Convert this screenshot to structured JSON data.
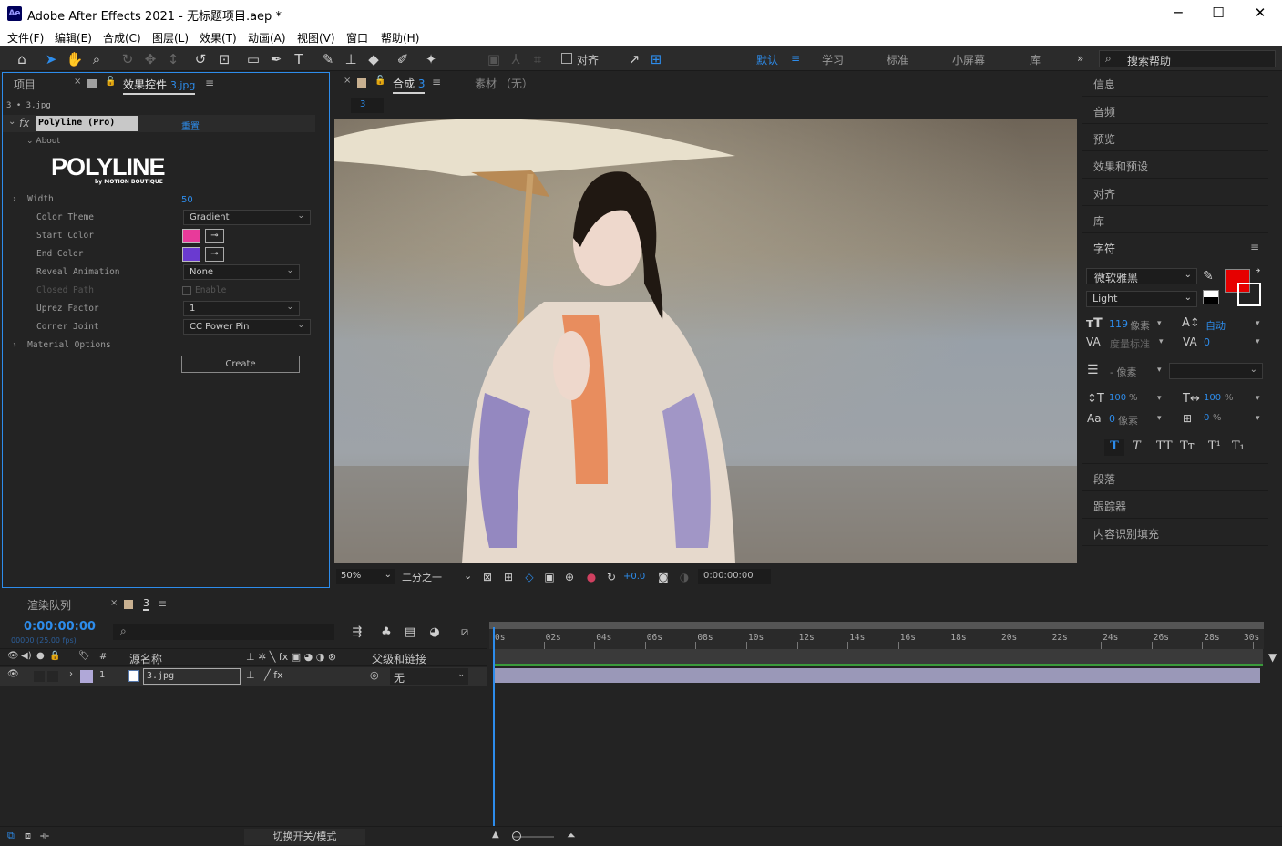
{
  "window": {
    "title": "Adobe After Effects 2021 - 无标题项目.aep *",
    "logo": "Ae",
    "minimize": "─",
    "maximize": "☐",
    "close": "✕"
  },
  "menu": [
    "文件(F)",
    "编辑(E)",
    "合成(C)",
    "图层(L)",
    "效果(T)",
    "动画(A)",
    "视图(V)",
    "窗口",
    "帮助(H)"
  ],
  "toolbar": {
    "align_label": "对齐",
    "workspaces": [
      "默认",
      "学习",
      "标准",
      "小屏幕",
      "库"
    ],
    "more": "»",
    "search_placeholder": "搜索帮助"
  },
  "left_panel": {
    "tab_project": "项目",
    "tab_effects": "效果控件",
    "tab_effects_file": "3.jpg",
    "breadcrumb": "3 • 3.jpg",
    "effect_name": "Polyline (Pro)",
    "reset": "重置",
    "about": "About",
    "logo_text": "POLYLINE",
    "logo_sub": "by MOTION BOUTIQUE",
    "params": [
      {
        "name": "Width",
        "value": "50"
      },
      {
        "name": "Color Theme",
        "value": "Gradient"
      },
      {
        "name": "Start Color",
        "value": ""
      },
      {
        "name": "End Color",
        "value": ""
      },
      {
        "name": "Reveal Animation",
        "value": "None"
      },
      {
        "name": "Closed Path",
        "value": "Enable"
      },
      {
        "name": "Uprez Factor",
        "value": "1"
      },
      {
        "name": "Corner Joint",
        "value": "CC Power Pin"
      },
      {
        "name": "Material Options",
        "value": ""
      }
    ],
    "create_button": "Create",
    "start_color": "#e83a9a",
    "end_color": "#6a3ad0"
  },
  "viewer": {
    "tab_comp": "合成",
    "tab_comp_name": "3",
    "tab_footage": "素材 （无）",
    "comp_chip": "3",
    "zoom": "50%",
    "resolution": "二分之一",
    "exposure": "+0.0",
    "timecode": "0:00:00:00"
  },
  "right_panel": {
    "items_top": [
      "信息",
      "音频",
      "预览",
      "效果和预设",
      "对齐",
      "库"
    ],
    "char_title": "字符",
    "font": "微软雅黑",
    "style": "Light",
    "font_size": "119",
    "font_size_unit": "像素",
    "leading": "自动",
    "kerning": "度量标准",
    "tracking": "0",
    "stroke_width": "- 像素",
    "v_scale": "100",
    "h_scale": "100",
    "percent": "%",
    "baseline": "0",
    "baseline_unit": "像素",
    "tsume": "0",
    "fill_color": "#e60000",
    "items_bottom": [
      "段落",
      "跟踪器",
      "内容识别填充"
    ]
  },
  "timeline": {
    "tab_render": "渲染队列",
    "tab_comp": "3",
    "timecode": "0:00:00:00",
    "timecode_sub": "00000 (25.00 fps)",
    "col_source": "源名称",
    "col_parent": "父级和链接",
    "col_index": "#",
    "layer_index": "1",
    "layer_name": "3.jpg",
    "parent_value": "无",
    "ruler": [
      "0s",
      "02s",
      "04s",
      "06s",
      "08s",
      "10s",
      "12s",
      "14s",
      "16s",
      "18s",
      "20s",
      "22s",
      "24s",
      "26s",
      "28s",
      "30s"
    ],
    "switches_modes": "切换开关/模式"
  }
}
